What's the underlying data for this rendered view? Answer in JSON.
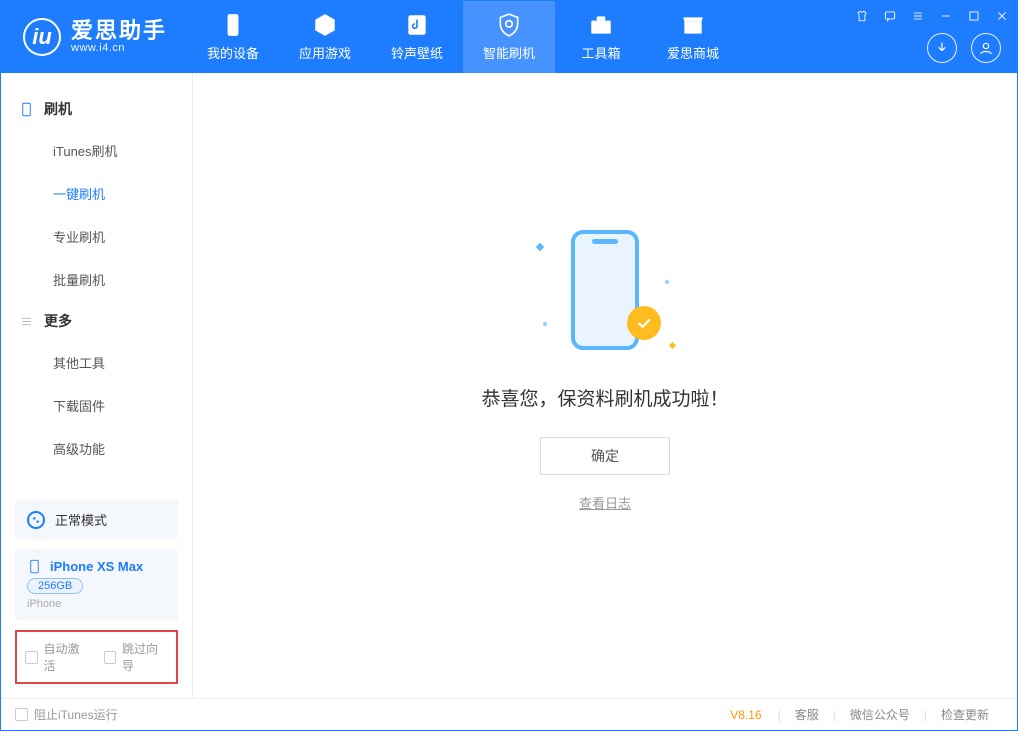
{
  "brand": {
    "title": "爱思助手",
    "url": "www.i4.cn"
  },
  "nav": [
    {
      "label": "我的设备",
      "icon": "device"
    },
    {
      "label": "应用游戏",
      "icon": "cube"
    },
    {
      "label": "铃声壁纸",
      "icon": "music"
    },
    {
      "label": "智能刷机",
      "icon": "shield",
      "active": true
    },
    {
      "label": "工具箱",
      "icon": "toolbox"
    },
    {
      "label": "爱思商城",
      "icon": "store"
    }
  ],
  "sidebar": {
    "group1_title": "刷机",
    "group1_items": [
      "iTunes刷机",
      "一键刷机",
      "专业刷机",
      "批量刷机"
    ],
    "group1_active_index": 1,
    "group2_title": "更多",
    "group2_items": [
      "其他工具",
      "下载固件",
      "高级功能"
    ]
  },
  "mode": {
    "label": "正常模式"
  },
  "device": {
    "name": "iPhone XS Max",
    "storage": "256GB",
    "type": "iPhone"
  },
  "options": {
    "auto_activate": "自动激活",
    "skip_setup": "跳过向导"
  },
  "main": {
    "success_title": "恭喜您，保资料刷机成功啦！",
    "ok_button": "确定",
    "view_log": "查看日志"
  },
  "statusbar": {
    "block_itunes": "阻止iTunes运行",
    "version": "V8.16",
    "links": [
      "客服",
      "微信公众号",
      "检查更新"
    ]
  }
}
